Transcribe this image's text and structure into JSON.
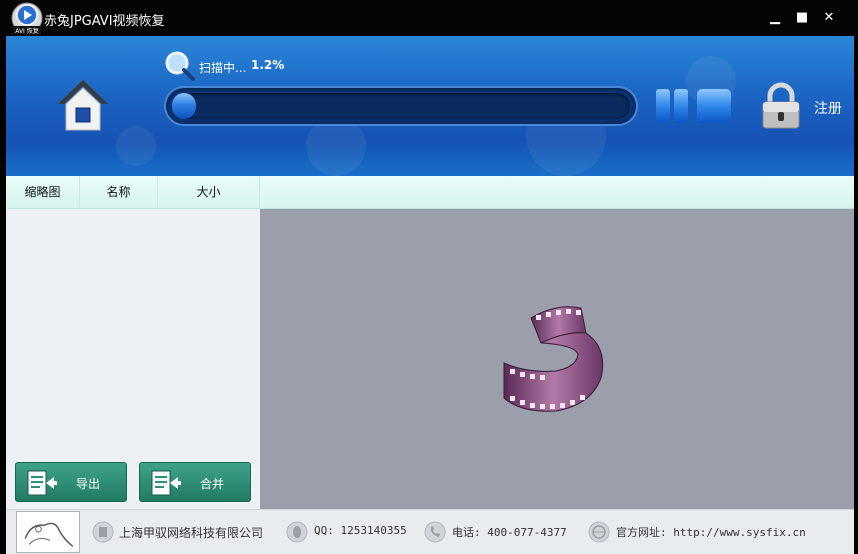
{
  "window": {
    "title": "赤兔JPGAVI视频恢复",
    "logo_text": "AVI 恢复",
    "controls": {
      "minimize": "▁",
      "maximize": "■",
      "close": "✕"
    }
  },
  "header": {
    "scan_label": "扫描中...",
    "scan_percent": "1.2%",
    "progress": 0.012,
    "register_label": "注册",
    "icons": [
      "home-icon",
      "search-icon",
      "pause-icon",
      "stop-icon",
      "lock-icon"
    ]
  },
  "columns": [
    "缩略图",
    "名称",
    "大小"
  ],
  "actions": {
    "export_label": "导出",
    "merge_label": "合并"
  },
  "footer": {
    "company": "上海甲驭网络科技有限公司",
    "qq": "QQ: 1253140355",
    "phone": "电话: 400-077-4377",
    "website": "官方网址: http://www.sysfix.cn"
  },
  "colors": {
    "header_blue": "#1b63c2",
    "column_header": "#d6f4ef",
    "action_green": "#2e8e75",
    "preview_gray": "#9a9fab"
  }
}
